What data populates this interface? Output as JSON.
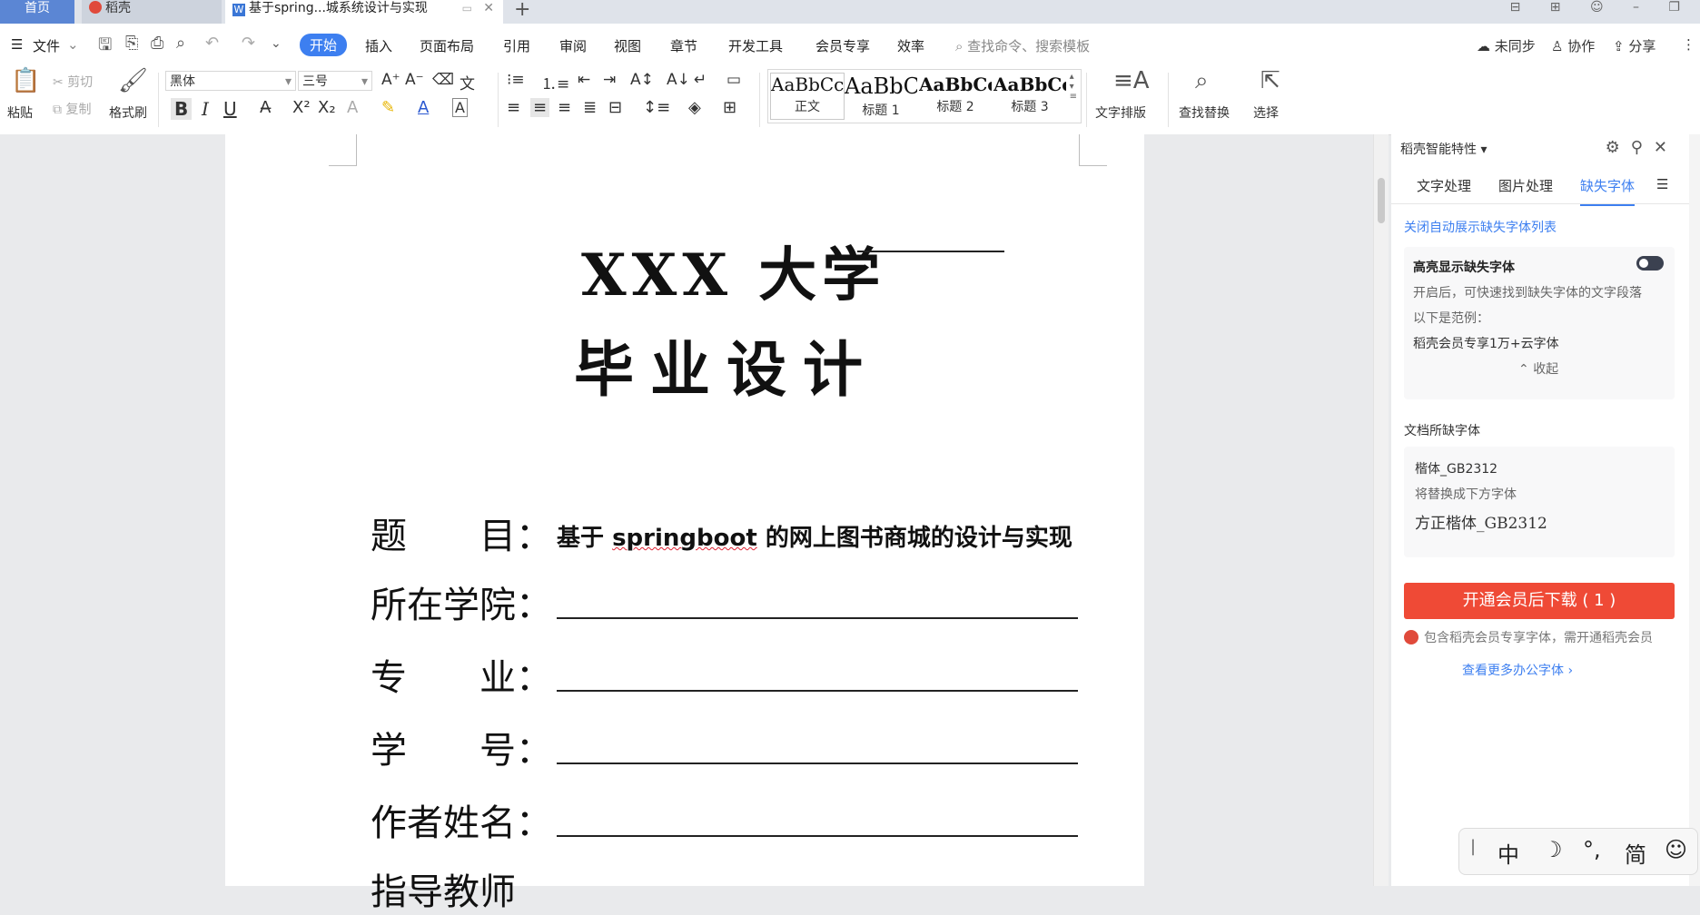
{
  "tabs": {
    "home": "首页",
    "daoke": "稻壳",
    "doc": "基于spring...城系统设计与实现",
    "doc_icon": "W",
    "close": "✕",
    "new": "+"
  },
  "window": {
    "controls": "⊟ ⊞ ☺ – ❐"
  },
  "menu": {
    "file": "文件",
    "items": [
      "开始",
      "插入",
      "页面布局",
      "引用",
      "审阅",
      "视图",
      "章节",
      "开发工具",
      "会员专享",
      "效率"
    ],
    "search_placeholder": "查找命令、搜索模板",
    "sync": "未同步",
    "collab": "协作",
    "share": "分享"
  },
  "ribbon": {
    "paste": "粘贴",
    "cut": "剪切",
    "copy": "复制",
    "format_painter": "格式刷",
    "font_name": "黑体",
    "font_size": "三号",
    "bold": "B",
    "italic": "I",
    "underline": "U",
    "styles": [
      {
        "sample": "AaBbCcI",
        "name": "正文"
      },
      {
        "sample": "AaBbC",
        "name": "标题 1"
      },
      {
        "sample": "AaBbCcI",
        "name": "标题 2"
      },
      {
        "sample": "AaBbCc",
        "name": "标题 3"
      }
    ],
    "text_layout": "文字排版",
    "find_replace": "查找替换",
    "select": "选择"
  },
  "document": {
    "title1": "XXX 大学",
    "title2": "毕业设计",
    "fields": [
      {
        "label": "题　　目：",
        "value": ""
      },
      {
        "label": "所在学院：",
        "value": ""
      },
      {
        "label": "专　　业：",
        "value": ""
      },
      {
        "label": "学　　号：",
        "value": ""
      },
      {
        "label": "作者姓名：",
        "value": ""
      },
      {
        "label": "指导教师",
        "value": ""
      }
    ],
    "topic_prefix": "基于 ",
    "topic_spell": "springboot",
    "topic_suffix": " 的网上图书商城的设计与实现"
  },
  "panel": {
    "header": "稻壳智能特性",
    "tabs": [
      "文字处理",
      "图片处理",
      "缺失字体"
    ],
    "active_tab": "缺失字体",
    "close_auto": "关闭自动展示缺失字体列表",
    "highlight_title": "高亮显示缺失字体",
    "highlight_desc": "开启后，可快速找到缺失字体的文字段落",
    "example_label": "以下是范例：",
    "example_text": "稻壳会员专享1万+云字体",
    "collapse": "收起",
    "doc_missing": "文档所缺字体",
    "missing_font": "楷体_GB2312",
    "replace_label": "将替换成下方字体",
    "replace_font": "方正楷体_GB2312",
    "download_btn": "开通会员后下载 ( 1 )",
    "note": "包含稻壳会员专享字体，需开通稻壳会员",
    "more_link": "查看更多办公字体 ›"
  },
  "ime": {
    "items": [
      "中",
      "☽",
      "°,",
      "简",
      "☺"
    ]
  },
  "colors": {
    "accent": "#3d7ff0",
    "download": "#ef4a36",
    "home_tab": "#5b86d4"
  }
}
